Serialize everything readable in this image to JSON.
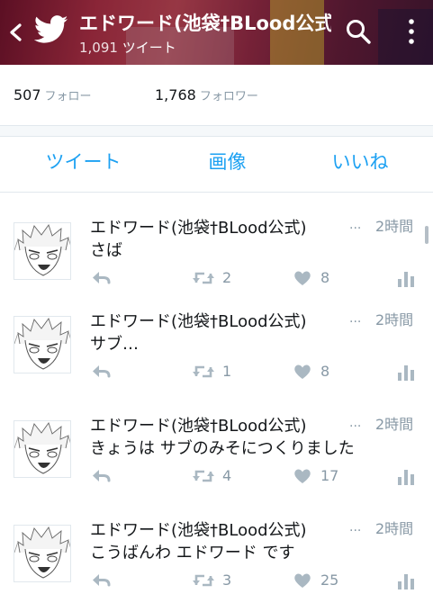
{
  "header": {
    "title": "エドワード(池袋†BLood公式)",
    "tweet_count": "1,091",
    "tweet_count_label": "ツイート",
    "back_icon": "back-arrow-icon",
    "logo_icon": "twitter-bird-icon",
    "search_icon": "search-icon",
    "more_icon": "more-vertical-icon"
  },
  "stats": {
    "following_count": "507",
    "following_label": "フォロー",
    "followers_count": "1,768",
    "followers_label": "フォロワー"
  },
  "tabs": [
    {
      "label": "ツイート",
      "active": true
    },
    {
      "label": "画像",
      "active": false
    },
    {
      "label": "いいね",
      "active": false
    }
  ],
  "tweets": [
    {
      "name": "エドワード(池袋†BLood公式)",
      "ellipsis": "...",
      "time": "2時間",
      "text": "さば",
      "retweets": "2",
      "likes": "8"
    },
    {
      "name": "エドワード(池袋†BLood公式)",
      "ellipsis": "...",
      "time": "2時間",
      "text": "サブ…",
      "retweets": "1",
      "likes": "8"
    },
    {
      "name": "エドワード(池袋†BLood公式)",
      "ellipsis": "...",
      "time": "2時間",
      "text": "きょうは サブのみそにつくりました",
      "retweets": "4",
      "likes": "17"
    },
    {
      "name": "エドワード(池袋†BLood公式)",
      "ellipsis": "...",
      "time": "2時間",
      "text": "こうばんわ エドワード です",
      "retweets": "3",
      "likes": "25"
    }
  ],
  "colors": {
    "accent": "#1da1f2",
    "muted": "#8899a6",
    "icon": "#aab8c2",
    "divider": "#e1e8ed"
  }
}
